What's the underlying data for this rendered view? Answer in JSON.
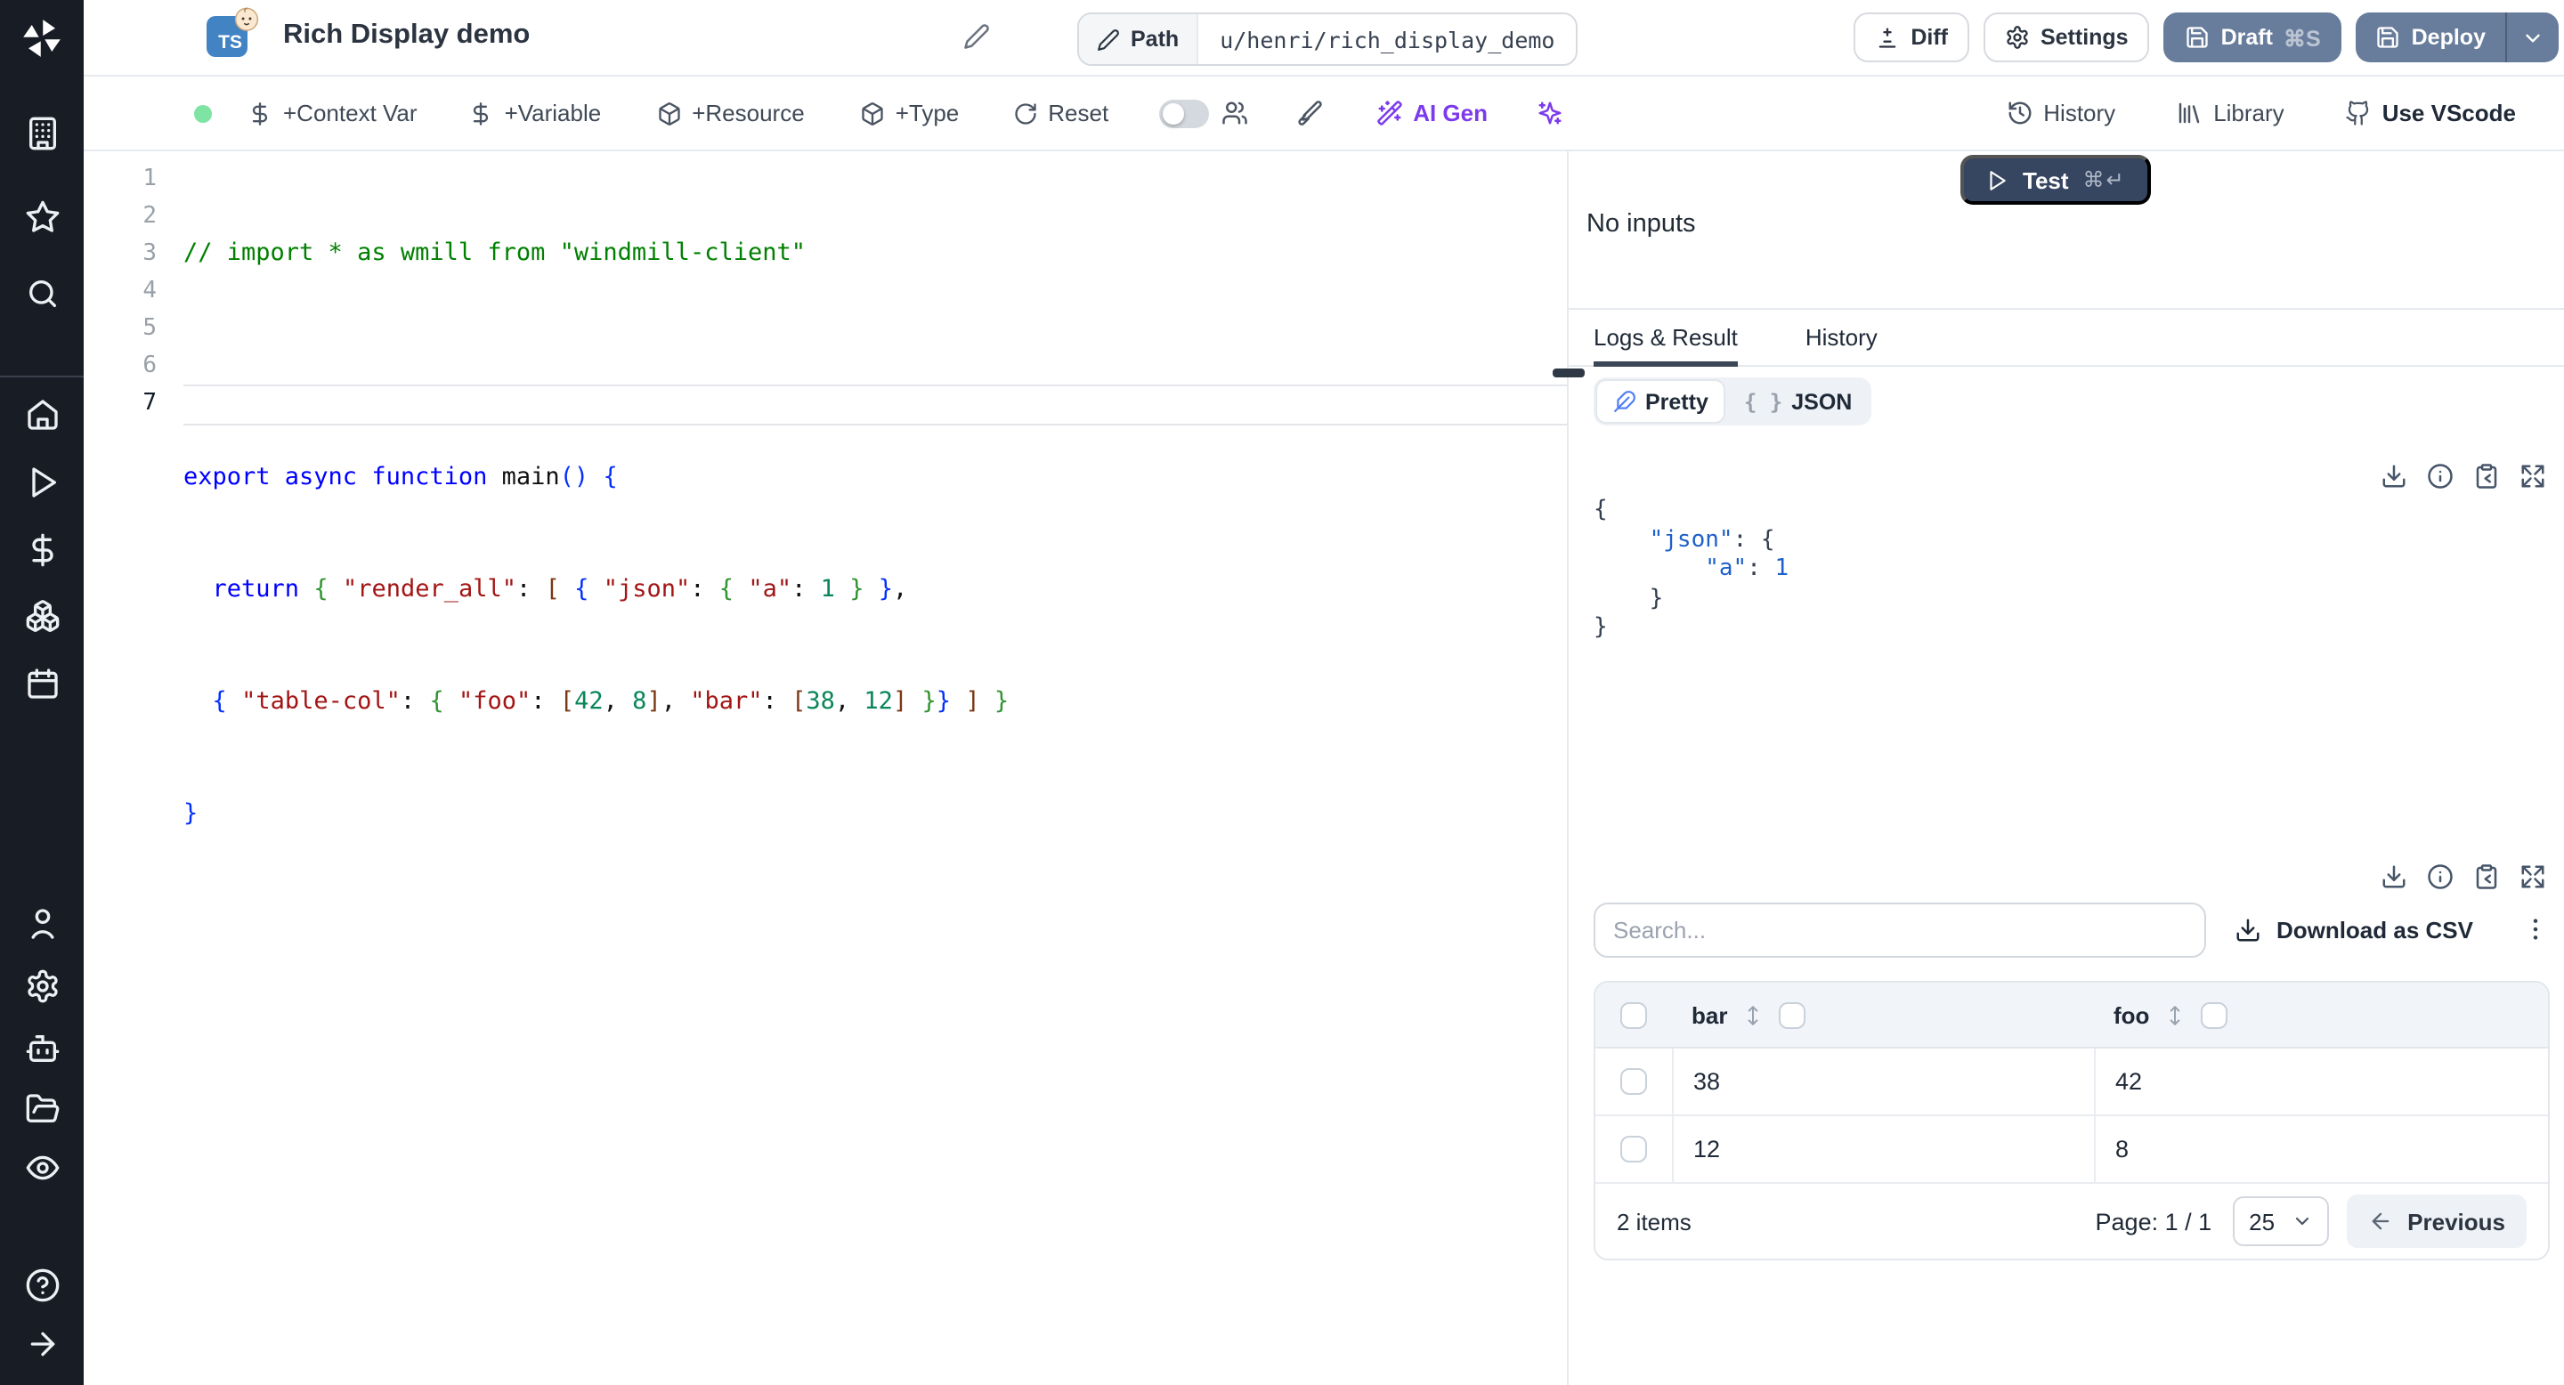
{
  "colors": {
    "rail_bg": "#181c24",
    "accent_slate_button": "#687c9c",
    "test_button": "#364560",
    "ai_purple": "#7c3aed",
    "status_green": "#7fe3a3",
    "ts_badge_blue": "#4283c4",
    "tab_underline": "#3b4656"
  },
  "sidebar": {
    "icons": [
      "windmill-logo",
      "building",
      "star",
      "search",
      "home",
      "play",
      "dollar-sign",
      "boxes",
      "calendar",
      "user",
      "settings-gear",
      "robot",
      "folder-open",
      "eye",
      "help-circle",
      "arrow-right"
    ]
  },
  "header": {
    "badge": "TS",
    "title": "Rich Display demo",
    "path_label": "Path",
    "path_value": "u/henri/rich_display_demo",
    "diff": "Diff",
    "settings": "Settings",
    "draft": "Draft",
    "draft_shortcut": "⌘S",
    "deploy": "Deploy"
  },
  "toolbar": {
    "context_var": "+Context Var",
    "variable": "+Variable",
    "resource": "+Resource",
    "type": "+Type",
    "reset": "Reset",
    "ai_gen": "AI Gen",
    "history": "History",
    "library": "Library",
    "vscode": "Use VScode"
  },
  "editor": {
    "line_numbers": [
      "1",
      "2",
      "3",
      "4",
      "5",
      "6",
      "7"
    ],
    "lines": {
      "l1": [
        {
          "t": "// import * as wmill from \"windmill-client\""
        }
      ],
      "l3": [
        {
          "t": "export async function "
        },
        {
          "t": "main"
        },
        {
          "t": "()"
        },
        {
          "t": " "
        },
        {
          "t": "{"
        }
      ],
      "l4": [
        {
          "t": "  "
        },
        {
          "t": "return"
        },
        {
          "t": " "
        },
        {
          "t": "{"
        },
        {
          "t": " "
        },
        {
          "t": "\"render_all\""
        },
        {
          "t": ": "
        },
        {
          "t": "["
        },
        {
          "t": " "
        },
        {
          "t": "{"
        },
        {
          "t": " "
        },
        {
          "t": "\"json\""
        },
        {
          "t": ": "
        },
        {
          "t": "{"
        },
        {
          "t": " "
        },
        {
          "t": "\"a\""
        },
        {
          "t": ": "
        },
        {
          "t": "1"
        },
        {
          "t": " }"
        },
        {
          "t": " }"
        },
        {
          "t": ","
        }
      ],
      "l5": [
        {
          "t": "  "
        },
        {
          "t": "{"
        },
        {
          "t": " "
        },
        {
          "t": "\"table-col\""
        },
        {
          "t": ": "
        },
        {
          "t": "{"
        },
        {
          "t": " "
        },
        {
          "t": "\"foo\""
        },
        {
          "t": ": "
        },
        {
          "t": "["
        },
        {
          "t": "42"
        },
        {
          "t": ", "
        },
        {
          "t": "8"
        },
        {
          "t": "]"
        },
        {
          "t": ", "
        },
        {
          "t": "\"bar\""
        },
        {
          "t": ": "
        },
        {
          "t": "["
        },
        {
          "t": "38"
        },
        {
          "t": ", "
        },
        {
          "t": "12"
        },
        {
          "t": "]"
        },
        {
          "t": " "
        },
        {
          "t": "}"
        },
        {
          "t": "}"
        },
        {
          "t": " "
        },
        {
          "t": "]"
        },
        {
          "t": " "
        },
        {
          "t": "}"
        }
      ],
      "l6": [
        {
          "t": "}"
        }
      ]
    }
  },
  "runner": {
    "test": "Test",
    "test_shortcut": "⌘↵",
    "no_inputs": "No inputs"
  },
  "result_panel": {
    "tabs": [
      "Logs & Result",
      "History"
    ],
    "view_pretty": "Pretty",
    "view_json": "JSON",
    "json_brace_glyph": "{ }",
    "actions": [
      "download",
      "info",
      "copy-to-clipboard",
      "expand"
    ],
    "json_lines": {
      "r1": [
        {
          "t": "{"
        }
      ],
      "r2": [
        {
          "t": "    "
        },
        {
          "t": "\"json\""
        },
        {
          "t": ": "
        },
        {
          "t": "{"
        }
      ],
      "r3": [
        {
          "t": "        "
        },
        {
          "t": "\"a\""
        },
        {
          "t": ": "
        },
        {
          "t": "1"
        }
      ],
      "r4": [
        {
          "t": "    "
        },
        {
          "t": "}"
        }
      ],
      "r5": [
        {
          "t": "}"
        }
      ]
    }
  },
  "table_panel": {
    "search_placeholder": "Search...",
    "download_csv": "Download as CSV",
    "columns": [
      "bar",
      "foo"
    ],
    "rows": [
      [
        "38",
        "42"
      ],
      [
        "12",
        "8"
      ]
    ],
    "items_count": "2 items",
    "page_label": "Page: 1 / 1",
    "page_size": "25",
    "previous": "Previous",
    "previous_arrow": "←"
  }
}
